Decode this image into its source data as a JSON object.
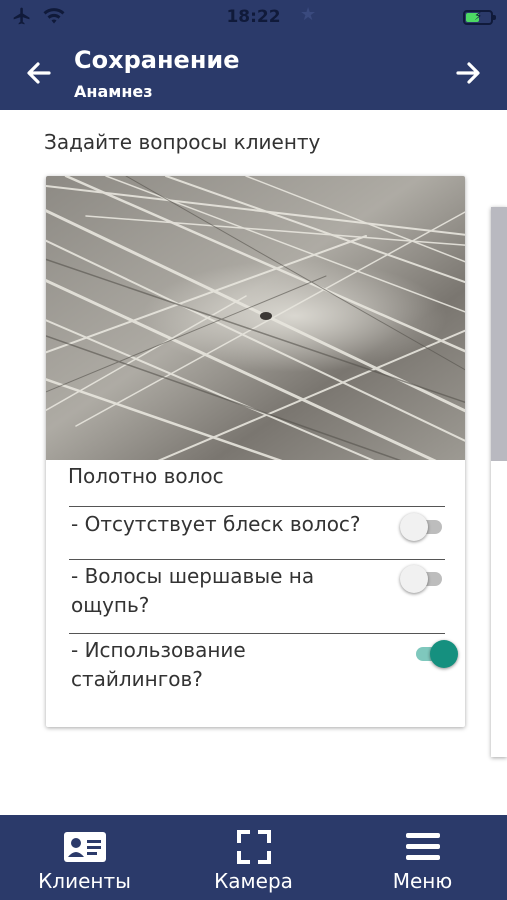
{
  "status_bar": {
    "time": "18:22",
    "icons": [
      "airplane-icon",
      "wifi-icon",
      "star-icon",
      "battery-charging-icon"
    ],
    "battery_color": "#4cd964",
    "battery_level": 0.55
  },
  "header": {
    "title": "Сохранение",
    "subtitle": "Анамнез",
    "back_icon": "arrow-left-icon",
    "forward_icon": "arrow-right-icon",
    "background": "#2b3a6a"
  },
  "main": {
    "prompt": "Задайте вопросы клиенту",
    "card": {
      "image": "hair-microscope-photo",
      "title": "Полотно волос",
      "questions": [
        {
          "text_lines": [
            "- Отсутствует блеск волос?"
          ],
          "enabled": false
        },
        {
          "text_lines": [
            "- Волосы шершавые на",
            "ощупь?"
          ],
          "enabled": false
        },
        {
          "text_lines": [
            "- Использование",
            "стайлингов?"
          ],
          "enabled": true
        }
      ],
      "toggle_on_color": "#15907f"
    }
  },
  "bottom_nav": {
    "items": [
      {
        "label": "Клиенты",
        "icon": "id-card-icon"
      },
      {
        "label": "Камера",
        "icon": "camera-frame-icon"
      },
      {
        "label": "Меню",
        "icon": "menu-icon"
      }
    ]
  }
}
